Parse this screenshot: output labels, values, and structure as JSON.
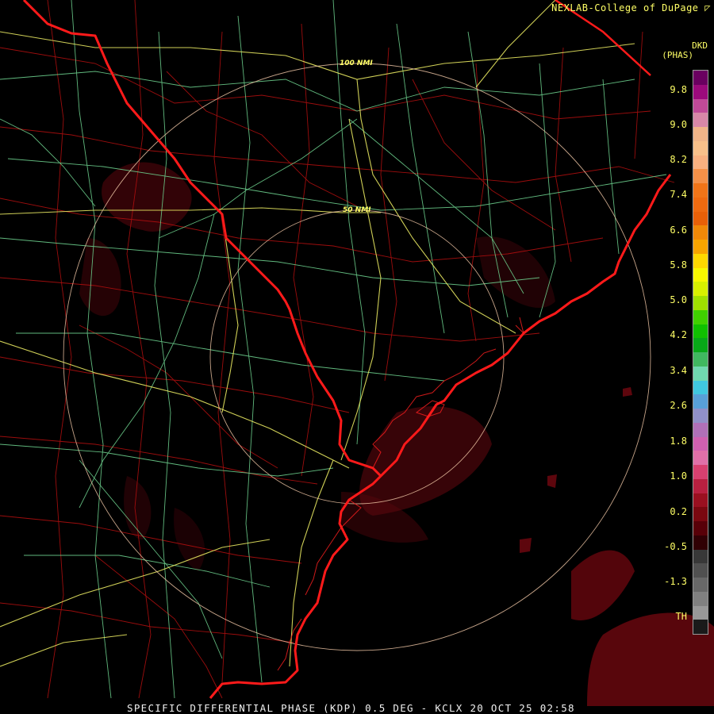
{
  "header": {
    "credit": "NEXLAB-College of DuPage"
  },
  "product": {
    "code": "DKD",
    "unit": "(PHAS)"
  },
  "legend": {
    "ticks": [
      "9.8",
      "9.0",
      "8.2",
      "7.4",
      "6.6",
      "5.8",
      "5.0",
      "4.2",
      "3.4",
      "2.6",
      "1.8",
      "1.0",
      "0.2",
      "-0.5",
      "-1.3",
      "TH"
    ],
    "colors": [
      "#6a0060",
      "#9c0a7c",
      "#c04a98",
      "#d888a8",
      "#f0b488",
      "#f8c08a",
      "#f8b080",
      "#f49048",
      "#f07418",
      "#ee6a10",
      "#e86008",
      "#f08808",
      "#f8a400",
      "#ffd800",
      "#f8f800",
      "#d8f000",
      "#a0e000",
      "#40d000",
      "#10c000",
      "#08a818",
      "#40b860",
      "#70d8b0",
      "#40c8e0",
      "#58a0d8",
      "#9090c8",
      "#b070b8",
      "#d060b0",
      "#e070a8",
      "#d84070",
      "#b82040",
      "#9a1020",
      "#7a0810",
      "#580008",
      "#300004",
      "#383838",
      "#505050",
      "#686868",
      "#808080",
      "#989898",
      "#1a1a1a"
    ]
  },
  "map": {
    "range_rings": [
      {
        "label": "100 NMI"
      },
      {
        "label": "50 NMI"
      }
    ],
    "colors": {
      "state_border": "#ff1a1a",
      "county_line": "#c01010",
      "highway": "#e8e860",
      "road": "#70d090",
      "ring": "#f0c8a0",
      "echo": "#7a0a10"
    }
  },
  "footer": {
    "caption": "SPECIFIC DIFFERENTIAL PHASE (KDP) 0.5 DEG - KCLX 20 OCT 25 02:58"
  }
}
